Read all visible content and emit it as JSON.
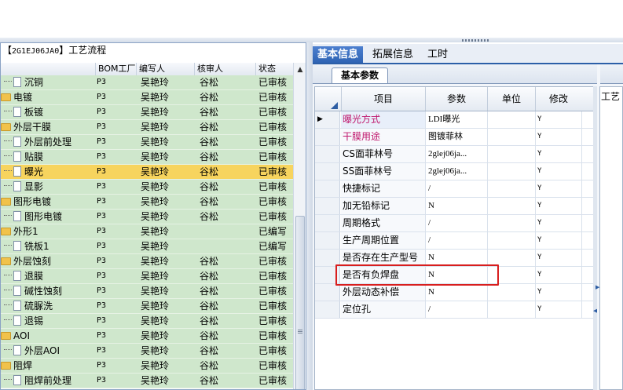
{
  "left_panel": {
    "title_open": "【",
    "code": "2G1EJ06JA0",
    "title_close": "】工艺流程",
    "columns": [
      "BOM工厂",
      "编写人",
      "核审人",
      "状态"
    ],
    "rows": [
      {
        "name": "沉铜",
        "level": 1,
        "type": "doc",
        "bom": "P3",
        "writer": "吴艳玲",
        "reviewer": "谷松",
        "status": "已审核"
      },
      {
        "name": "电镀",
        "level": 0,
        "type": "folder",
        "bom": "P3",
        "writer": "吴艳玲",
        "reviewer": "谷松",
        "status": "已审核"
      },
      {
        "name": "板镀",
        "level": 1,
        "type": "doc",
        "bom": "P3",
        "writer": "吴艳玲",
        "reviewer": "谷松",
        "status": "已审核"
      },
      {
        "name": "外层干膜",
        "level": 0,
        "type": "folder",
        "bom": "P3",
        "writer": "吴艳玲",
        "reviewer": "谷松",
        "status": "已审核"
      },
      {
        "name": "外层前处理",
        "level": 1,
        "type": "doc",
        "bom": "P3",
        "writer": "吴艳玲",
        "reviewer": "谷松",
        "status": "已审核"
      },
      {
        "name": "贴膜",
        "level": 1,
        "type": "doc",
        "bom": "P3",
        "writer": "吴艳玲",
        "reviewer": "谷松",
        "status": "已审核"
      },
      {
        "name": "曝光",
        "level": 1,
        "type": "doc",
        "bom": "P3",
        "writer": "吴艳玲",
        "reviewer": "谷松",
        "status": "已审核",
        "selected": true
      },
      {
        "name": "显影",
        "level": 1,
        "type": "doc",
        "bom": "P3",
        "writer": "吴艳玲",
        "reviewer": "谷松",
        "status": "已审核"
      },
      {
        "name": "图形电镀",
        "level": 0,
        "type": "folder",
        "bom": "P3",
        "writer": "吴艳玲",
        "reviewer": "谷松",
        "status": "已审核"
      },
      {
        "name": "图形电镀",
        "level": 1,
        "type": "doc",
        "bom": "P3",
        "writer": "吴艳玲",
        "reviewer": "谷松",
        "status": "已审核"
      },
      {
        "name": "外形1",
        "level": 0,
        "type": "folder",
        "bom": "P3",
        "writer": "吴艳玲",
        "reviewer": "",
        "status": "已编写"
      },
      {
        "name": "铣板1",
        "level": 1,
        "type": "doc",
        "bom": "P3",
        "writer": "吴艳玲",
        "reviewer": "",
        "status": "已编写"
      },
      {
        "name": "外层蚀刻",
        "level": 0,
        "type": "folder",
        "bom": "P3",
        "writer": "吴艳玲",
        "reviewer": "谷松",
        "status": "已审核"
      },
      {
        "name": "退膜",
        "level": 1,
        "type": "doc",
        "bom": "P3",
        "writer": "吴艳玲",
        "reviewer": "谷松",
        "status": "已审核"
      },
      {
        "name": "碱性蚀刻",
        "level": 1,
        "type": "doc",
        "bom": "P3",
        "writer": "吴艳玲",
        "reviewer": "谷松",
        "status": "已审核"
      },
      {
        "name": "硫脲洗",
        "level": 1,
        "type": "doc",
        "bom": "P3",
        "writer": "吴艳玲",
        "reviewer": "谷松",
        "status": "已审核"
      },
      {
        "name": "退锡",
        "level": 1,
        "type": "doc",
        "bom": "P3",
        "writer": "吴艳玲",
        "reviewer": "谷松",
        "status": "已审核"
      },
      {
        "name": "AOI",
        "level": 0,
        "type": "folder",
        "bom": "P3",
        "writer": "吴艳玲",
        "reviewer": "谷松",
        "status": "已审核"
      },
      {
        "name": "外层AOI",
        "level": 1,
        "type": "doc",
        "bom": "P3",
        "writer": "吴艳玲",
        "reviewer": "谷松",
        "status": "已审核"
      },
      {
        "name": "阻焊",
        "level": 0,
        "type": "folder",
        "bom": "P3",
        "writer": "吴艳玲",
        "reviewer": "谷松",
        "status": "已审核"
      },
      {
        "name": "阻焊前处理",
        "level": 1,
        "type": "doc",
        "bom": "P3",
        "writer": "吴艳玲",
        "reviewer": "谷松",
        "status": "已审核"
      }
    ]
  },
  "tabs": [
    "基本信息",
    "拓展信息",
    "工时"
  ],
  "subtab": "基本参数",
  "grid": {
    "columns": [
      "项目",
      "参数",
      "单位",
      "修改"
    ],
    "rows": [
      {
        "item": "曝光方式",
        "param": "LDI曝光",
        "unit": "",
        "mod": "Y",
        "magenta": true,
        "current": true
      },
      {
        "item": "干膜用途",
        "param": "图镀菲林",
        "unit": "",
        "mod": "Y",
        "magenta": true
      },
      {
        "item": "CS面菲林号",
        "param": "2glej06ja...",
        "unit": "",
        "mod": "Y"
      },
      {
        "item": "SS面菲林号",
        "param": "2glej06ja...",
        "unit": "",
        "mod": "Y"
      },
      {
        "item": "快捷标记",
        "param": "/",
        "unit": "",
        "mod": "Y"
      },
      {
        "item": "加无铅标记",
        "param": "N",
        "unit": "",
        "mod": "Y"
      },
      {
        "item": "周期格式",
        "param": "/",
        "unit": "",
        "mod": "Y"
      },
      {
        "item": "生产周期位置",
        "param": "/",
        "unit": "",
        "mod": "Y"
      },
      {
        "item": "是否存在生产型号",
        "param": "N",
        "unit": "",
        "mod": "Y"
      },
      {
        "item": "是否有负焊盘",
        "param": "N",
        "unit": "",
        "mod": "Y"
      },
      {
        "item": "外层动态补偿",
        "param": "N",
        "unit": "",
        "mod": "Y"
      },
      {
        "item": "定位孔",
        "param": "/",
        "unit": "",
        "mod": "Y"
      }
    ]
  },
  "right_pane_label": "工艺",
  "colors": {
    "accent": "#2f64b4",
    "row_green": "#cfe7cc",
    "row_selected": "#f7d45e",
    "highlight_box": "#d81e1e",
    "magenta_text": "#c0186d"
  }
}
